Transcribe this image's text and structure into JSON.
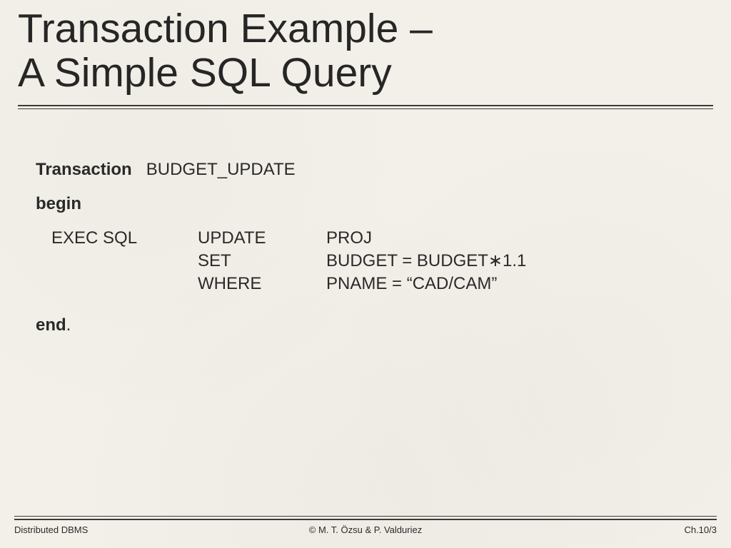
{
  "title_line1": "Transaction Example –",
  "title_line2": "A Simple SQL Query",
  "transaction_label": "Transaction",
  "transaction_name": "BUDGET_UPDATE",
  "begin": "begin",
  "exec": "EXEC SQL",
  "sql": {
    "kw1": "UPDATE",
    "arg1": "PROJ",
    "kw2": "SET",
    "arg2": "BUDGET = BUDGET∗​1.1",
    "kw3": "WHERE",
    "arg3": "PNAME = “CAD/CAM”"
  },
  "end": "end",
  "end_dot": ".",
  "footer_left": "Distributed DBMS",
  "footer_center": "© M. T. Özsu & P. Valduriez",
  "footer_right": "Ch.10/3"
}
